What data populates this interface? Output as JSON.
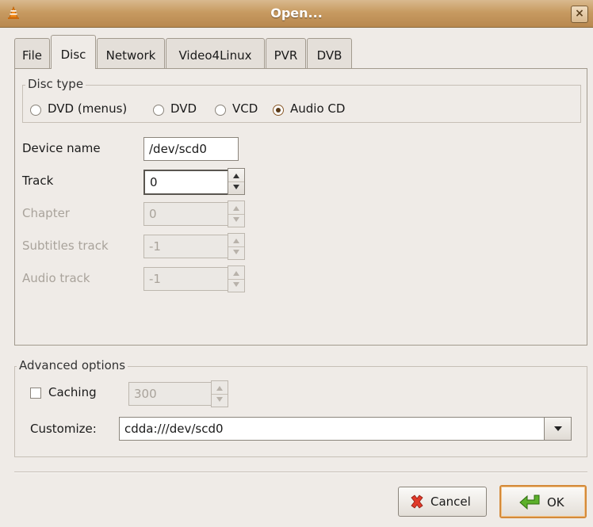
{
  "window": {
    "title": "Open...",
    "close_label": "×"
  },
  "tabs": [
    {
      "label": "File"
    },
    {
      "label": "Disc",
      "active": true
    },
    {
      "label": "Network"
    },
    {
      "label": "Video4Linux"
    },
    {
      "label": "PVR"
    },
    {
      "label": "DVB"
    }
  ],
  "disc_type": {
    "label": "Disc type",
    "options": [
      {
        "label": "DVD (menus)",
        "checked": false
      },
      {
        "label": "DVD",
        "checked": false
      },
      {
        "label": "VCD",
        "checked": false
      },
      {
        "label": "Audio CD",
        "checked": true
      }
    ]
  },
  "fields": {
    "device_name": {
      "label": "Device name",
      "value": "/dev/scd0"
    },
    "track": {
      "label": "Track",
      "value": "0"
    },
    "chapter": {
      "label": "Chapter",
      "value": "0",
      "disabled": true
    },
    "subtitles_track": {
      "label": "Subtitles track",
      "value": "-1",
      "disabled": true
    },
    "audio_track": {
      "label": "Audio track",
      "value": "-1",
      "disabled": true
    }
  },
  "advanced": {
    "label": "Advanced options",
    "caching": {
      "label": "Caching",
      "checked": false,
      "value": "300",
      "disabled": true
    },
    "customize": {
      "label": "Customize:",
      "value": "cdda:///dev/scd0"
    }
  },
  "buttons": {
    "cancel": {
      "label": "Cancel",
      "icon": "cancel-icon"
    },
    "ok": {
      "label": "OK",
      "icon": "ok-arrow-icon"
    }
  }
}
